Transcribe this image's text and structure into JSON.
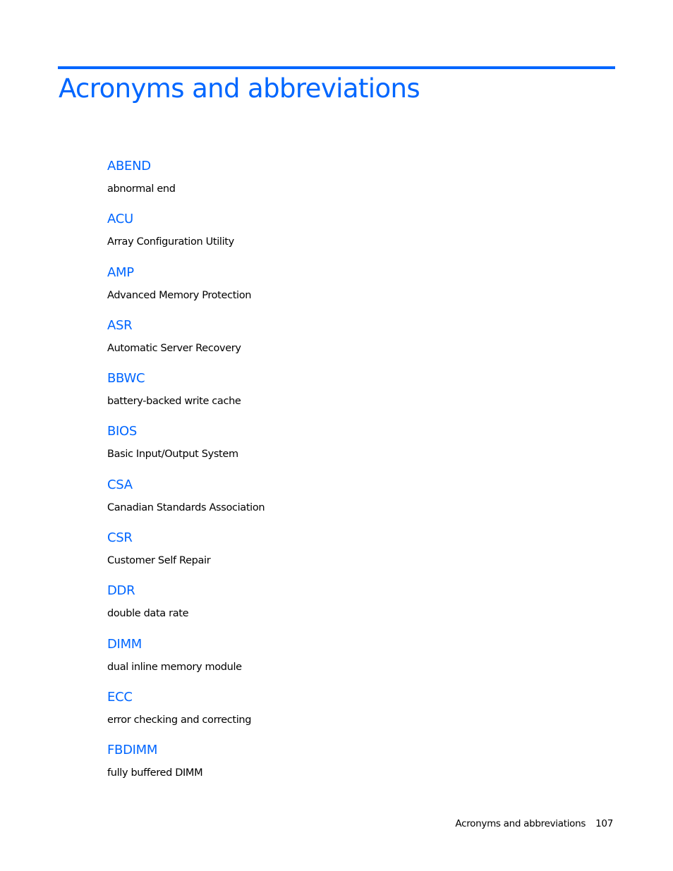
{
  "page": {
    "title": "Acronyms and abbreviations",
    "accent_color": "#0066FF"
  },
  "glossary": {
    "entries": [
      {
        "term": "ABEND",
        "definition": "abnormal end"
      },
      {
        "term": "ACU",
        "definition": "Array Configuration Utility"
      },
      {
        "term": "AMP",
        "definition": "Advanced Memory Protection"
      },
      {
        "term": "ASR",
        "definition": "Automatic Server Recovery"
      },
      {
        "term": "BBWC",
        "definition": "battery-backed write cache"
      },
      {
        "term": "BIOS",
        "definition": "Basic Input/Output System"
      },
      {
        "term": "CSA",
        "definition": "Canadian Standards Association"
      },
      {
        "term": "CSR",
        "definition": "Customer Self Repair"
      },
      {
        "term": "DDR",
        "definition": "double data rate"
      },
      {
        "term": "DIMM",
        "definition": "dual inline memory module"
      },
      {
        "term": "ECC",
        "definition": "error checking and correcting"
      },
      {
        "term": "FBDIMM",
        "definition": "fully buffered DIMM"
      }
    ]
  },
  "footer": {
    "section": "Acronyms and abbreviations",
    "page_number": "107"
  }
}
